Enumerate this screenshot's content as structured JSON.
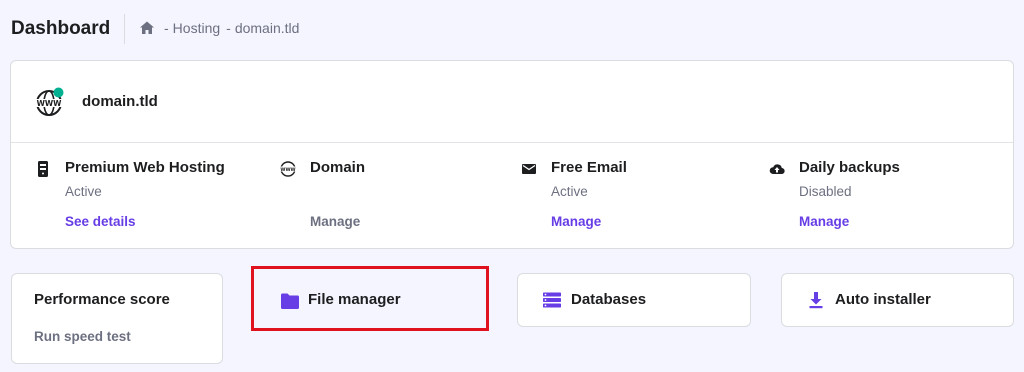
{
  "header": {
    "title": "Dashboard",
    "breadcrumb": [
      "Hosting",
      "domain.tld"
    ],
    "separator": "-"
  },
  "domain_card": {
    "domain": "domain.tld",
    "icon": "www-globe-icon",
    "status_dot_color": "#00b090",
    "services": [
      {
        "icon": "server-icon",
        "title": "Premium Web Hosting",
        "status": "Active",
        "link": "See details"
      },
      {
        "icon": "www-icon",
        "title": "Domain",
        "status": "",
        "link": "Manage"
      },
      {
        "icon": "mail-icon",
        "title": "Free Email",
        "status": "Active",
        "link": "Manage"
      },
      {
        "icon": "cloud-upload-icon",
        "title": "Daily backups",
        "status": "Disabled",
        "link": "Manage"
      }
    ]
  },
  "tiles": {
    "performance": {
      "title": "Performance score",
      "link": "Run speed test"
    },
    "file_manager": {
      "label": "File manager",
      "icon": "folder-icon"
    },
    "databases": {
      "label": "Databases",
      "icon": "database-icon"
    },
    "auto_installer": {
      "label": "Auto installer",
      "icon": "download-icon"
    }
  },
  "colors": {
    "accent": "#673de6",
    "highlight_border": "#e1121f",
    "background": "#f4f5ff"
  }
}
